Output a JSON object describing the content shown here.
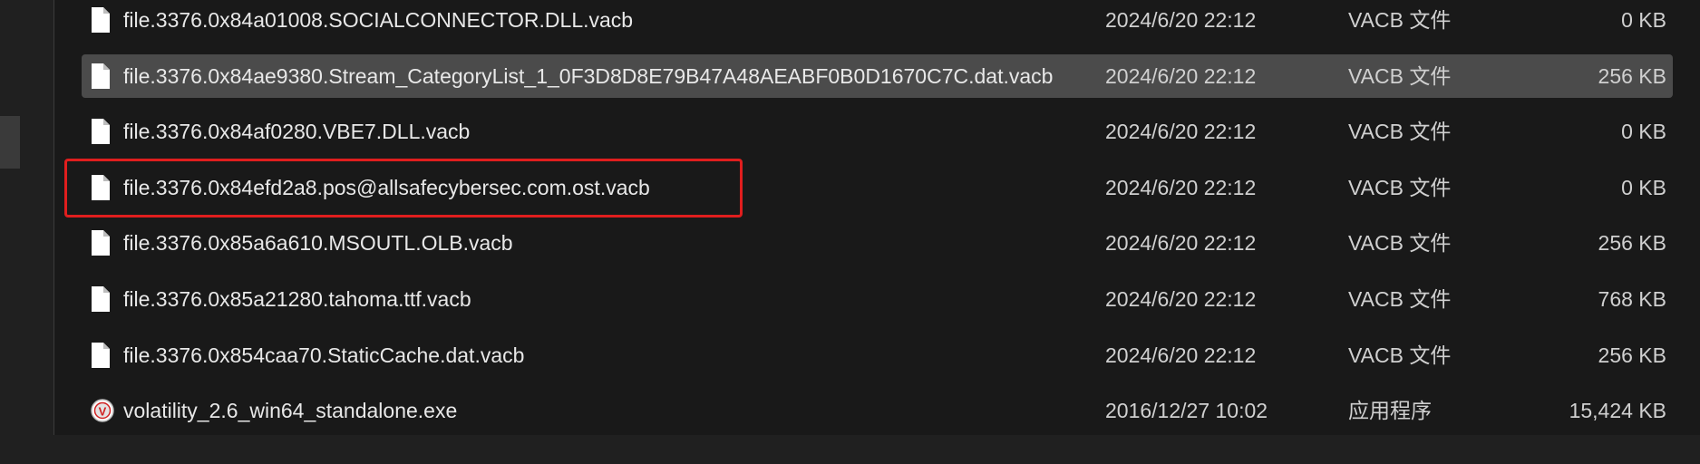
{
  "files": [
    {
      "name": "file.3376.0x84a01008.SOCIALCONNECTOR.DLL.vacb",
      "date": "2024/6/20 22:12",
      "type": "VACB 文件",
      "size": "0 KB",
      "icon": "file-icon",
      "selected": false
    },
    {
      "name": "file.3376.0x84ae9380.Stream_CategoryList_1_0F3D8D8E79B47A48AEABF0B0D1670C7C.dat.vacb",
      "date": "2024/6/20 22:12",
      "type": "VACB 文件",
      "size": "256 KB",
      "icon": "file-icon",
      "selected": true
    },
    {
      "name": "file.3376.0x84af0280.VBE7.DLL.vacb",
      "date": "2024/6/20 22:12",
      "type": "VACB 文件",
      "size": "0 KB",
      "icon": "file-icon",
      "selected": false
    },
    {
      "name": "file.3376.0x84efd2a8.pos@allsafecybersec.com.ost.vacb",
      "date": "2024/6/20 22:12",
      "type": "VACB 文件",
      "size": "0 KB",
      "icon": "file-icon",
      "selected": false,
      "highlighted": true
    },
    {
      "name": "file.3376.0x85a6a610.MSOUTL.OLB.vacb",
      "date": "2024/6/20 22:12",
      "type": "VACB 文件",
      "size": "256 KB",
      "icon": "file-icon",
      "selected": false
    },
    {
      "name": "file.3376.0x85a21280.tahoma.ttf.vacb",
      "date": "2024/6/20 22:12",
      "type": "VACB 文件",
      "size": "768 KB",
      "icon": "file-icon",
      "selected": false
    },
    {
      "name": "file.3376.0x854caa70.StaticCache.dat.vacb",
      "date": "2024/6/20 22:12",
      "type": "VACB 文件",
      "size": "256 KB",
      "icon": "file-icon",
      "selected": false
    },
    {
      "name": "volatility_2.6_win64_standalone.exe",
      "date": "2016/12/27 10:02",
      "type": "应用程序",
      "size": "15,424 KB",
      "icon": "volatility-app-icon",
      "selected": false
    }
  ],
  "colors": {
    "background": "#191919",
    "selected_row": "#4b4b4b",
    "highlight_box": "#e01e1e",
    "text": "#e8e8e8"
  }
}
